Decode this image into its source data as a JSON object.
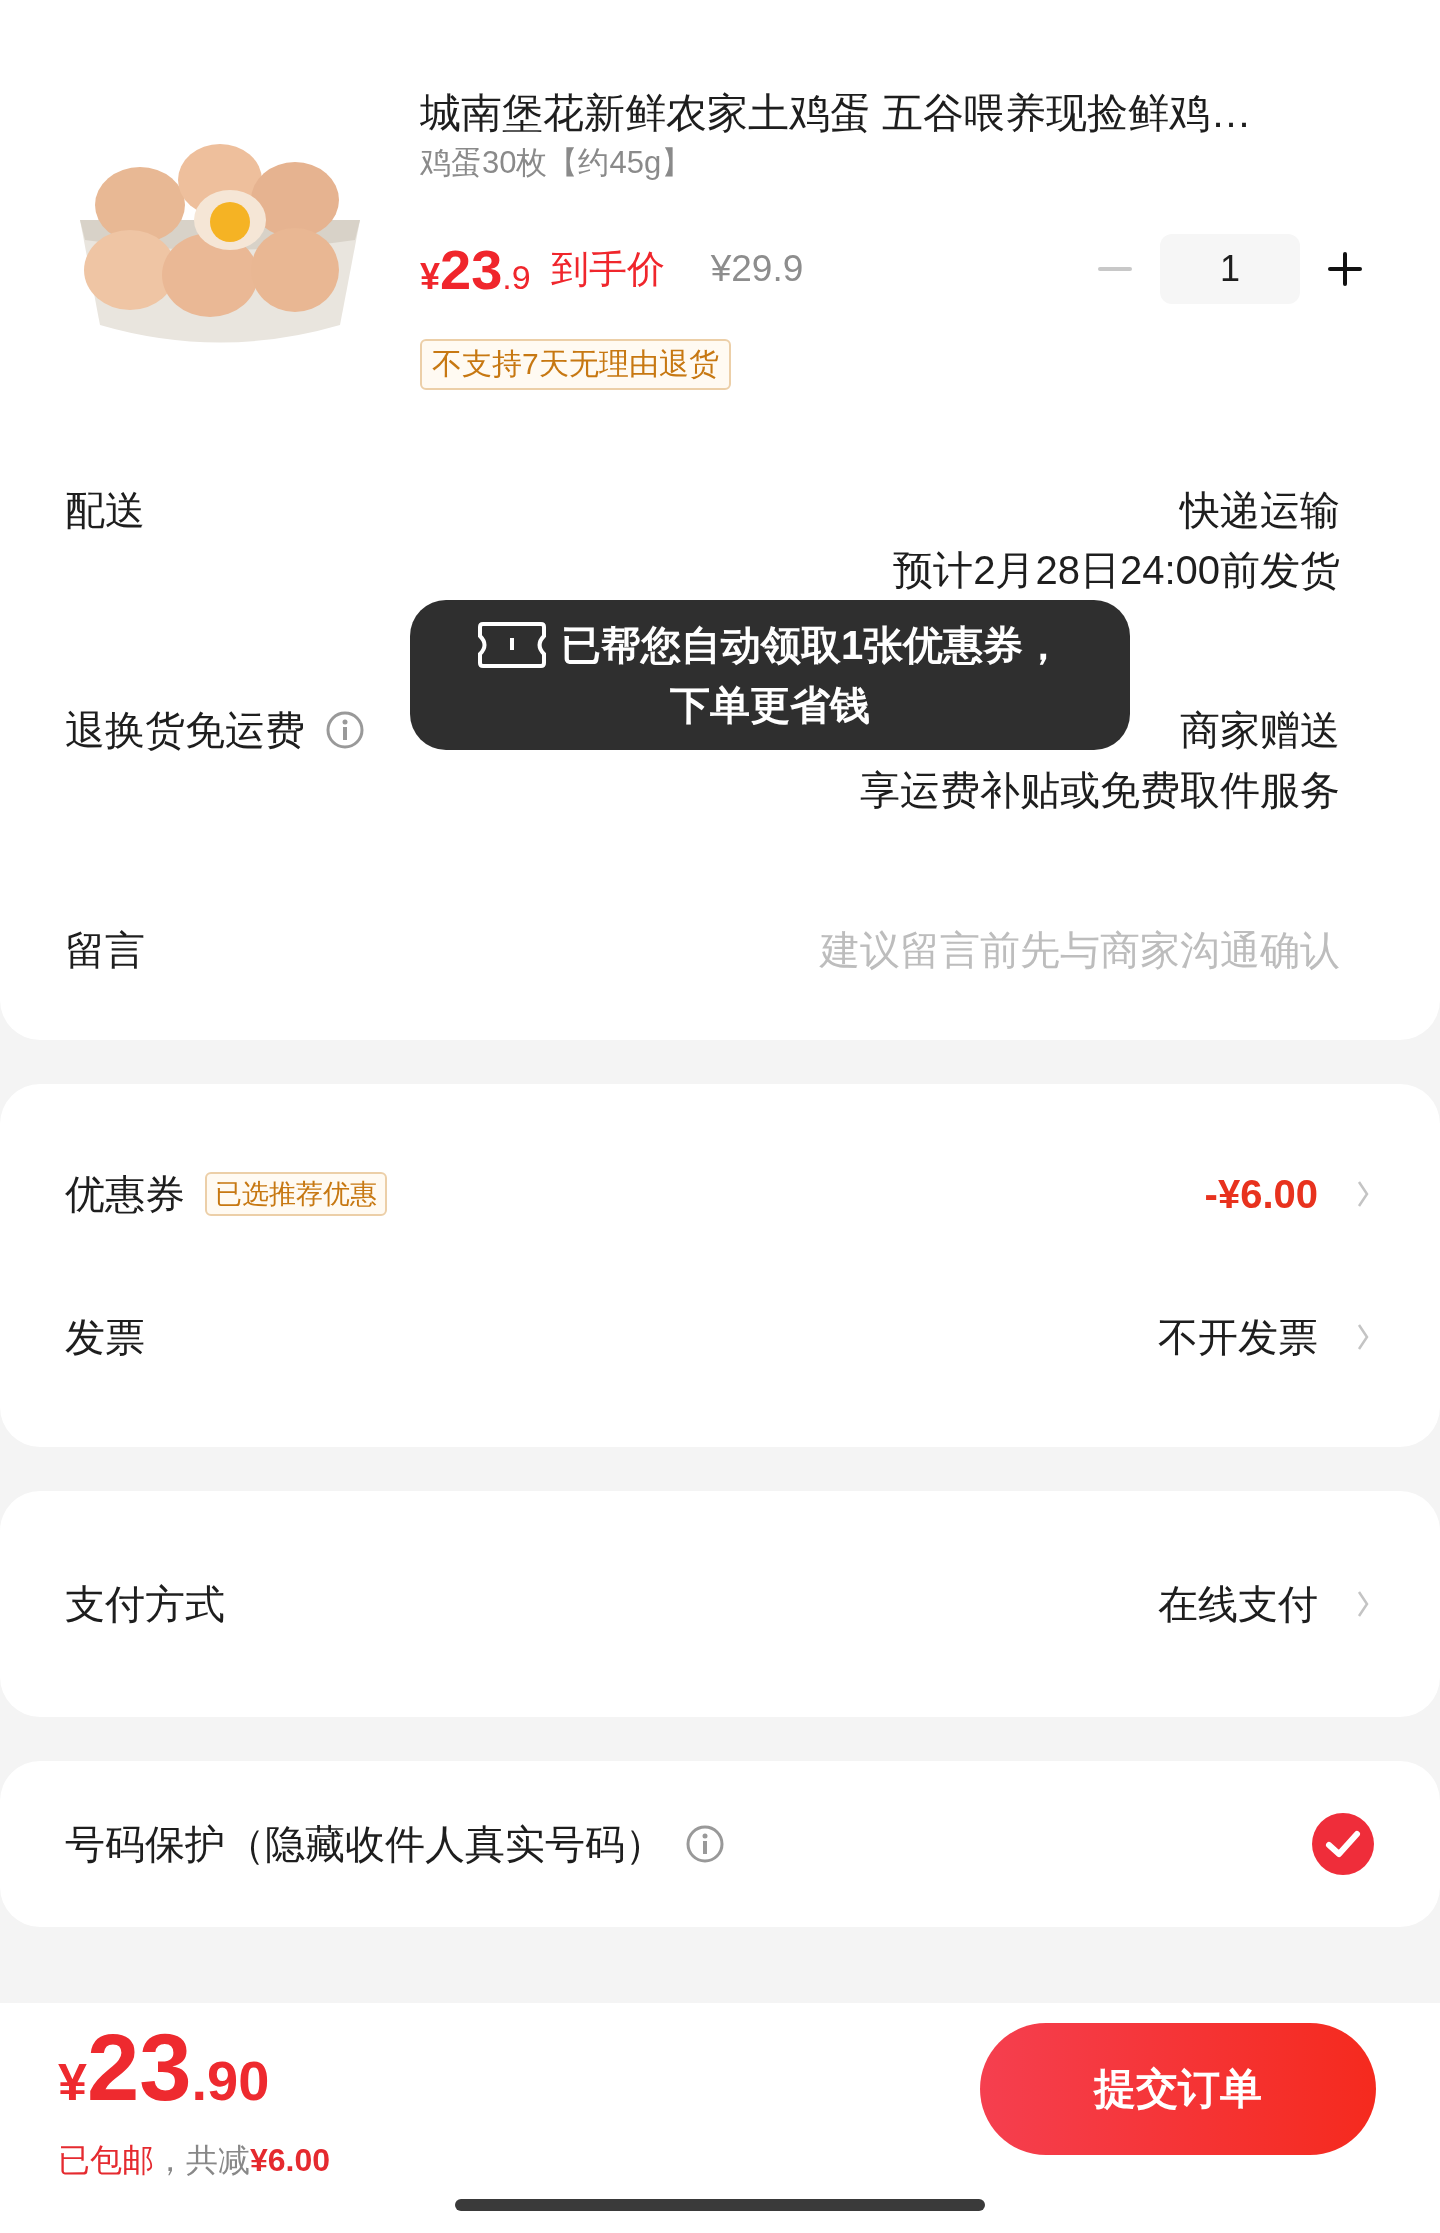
{
  "product": {
    "kind": "picture",
    "title": "城南堡花新鲜农家土鸡蛋 五谷喂养现捡鲜鸡…",
    "spec": "鸡蛋30枚【约45g】",
    "price_symbol": "¥",
    "price_int": "23",
    "price_dec": ".9",
    "price_label": "到手价",
    "original_price": "¥29.9",
    "quantity": "1",
    "minus_disabled": true,
    "tag": "不支持7天无理由退货"
  },
  "order_rows": [
    {
      "kind": "info",
      "label": "配送",
      "value": "快递运输",
      "note": "预计2月28日24:00前发货"
    },
    {
      "kind": "info",
      "label": "退换货免运费",
      "value": "商家赠送",
      "note": "享运费补贴或免费取件服务",
      "info_icon": true
    },
    {
      "kind": "input",
      "label": "留言",
      "placeholder": "建议留言前先与商家沟通确认"
    }
  ],
  "toast": {
    "text_1": "已帮您自动领取1张优惠券，",
    "text_2": "下单更省钱"
  },
  "sections": [
    {
      "rows": [
        {
          "kind": "link",
          "label": "优惠券",
          "tag": "已选推荐优惠",
          "value": "-¥6.00",
          "highlight": true
        },
        {
          "kind": "link",
          "label": "发票",
          "value": "不开发票",
          "highlight": false
        }
      ]
    },
    {
      "rows": [
        {
          "kind": "link",
          "label": "支付方式",
          "value": "在线支付",
          "highlight": false
        }
      ]
    },
    {
      "rows": [
        {
          "kind": "check",
          "label": "号码保护（隐藏收件人真实号码）",
          "info_icon": true,
          "checked": true
        }
      ]
    }
  ],
  "footer": {
    "price_symbol": "¥",
    "price_int": "23",
    "price_dec": ".90",
    "shipping": "已包邮",
    "saving_label": "，共减",
    "saving": "¥6.00",
    "submit": "提交订单"
  }
}
